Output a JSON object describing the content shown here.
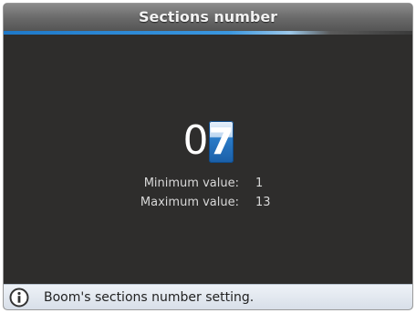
{
  "window": {
    "title": "Sections number"
  },
  "value": {
    "tens_digit": "0",
    "ones_digit": "7"
  },
  "limits": {
    "min_label": "Minimum value:",
    "min_value": "1",
    "max_label": "Maximum value:",
    "max_value": "13"
  },
  "status": {
    "icon": "info-icon",
    "text": "Boom's sections number setting."
  },
  "colors": {
    "accent": "#2c7cc8",
    "background": "#2e2d2c"
  }
}
